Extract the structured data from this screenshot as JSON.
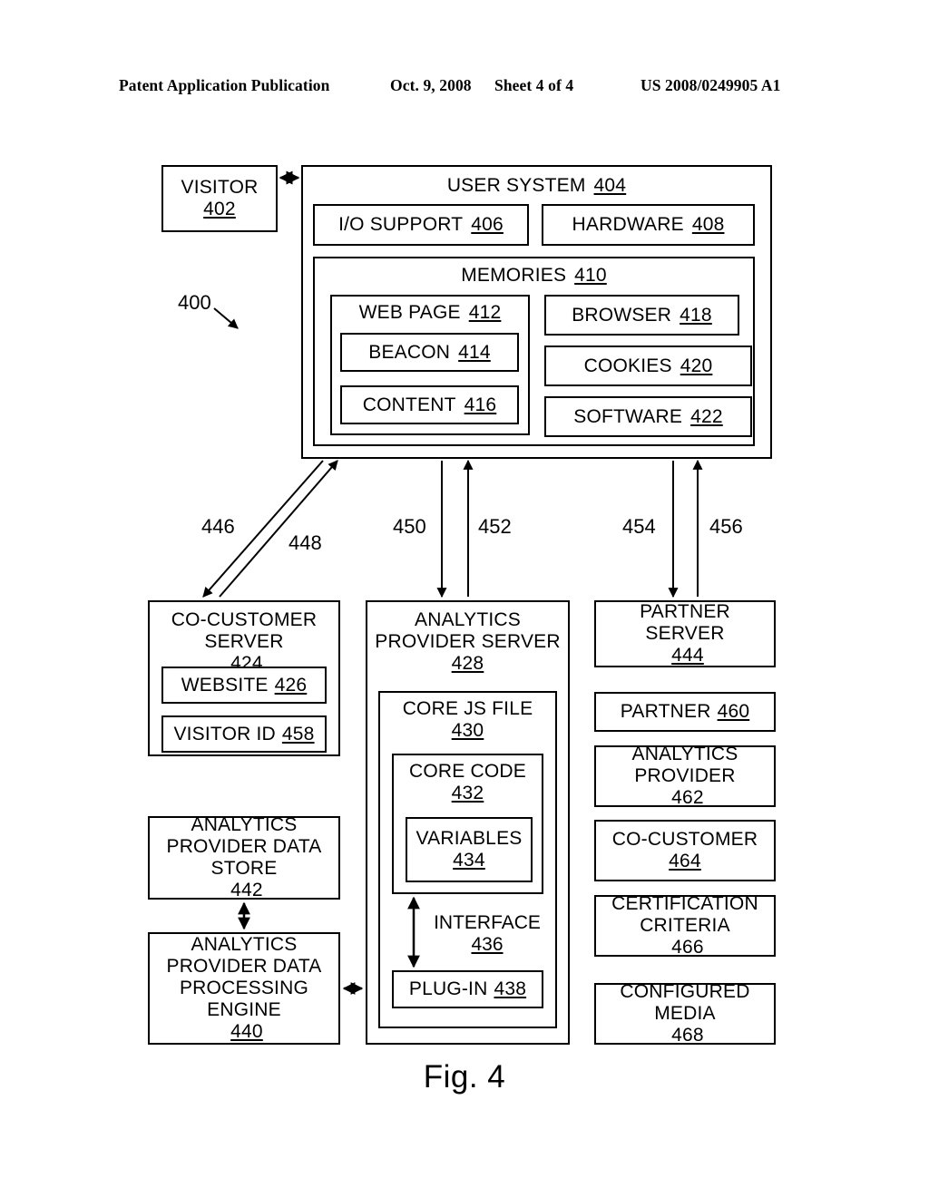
{
  "header": {
    "publication": "Patent Application Publication",
    "date": "Oct. 9, 2008",
    "sheet": "Sheet 4 of 4",
    "number": "US 2008/0249905 A1"
  },
  "figure": {
    "caption": "Fig. 4",
    "system_ref": "400"
  },
  "diagram": {
    "visitor": {
      "label": "VISITOR",
      "ref": "402"
    },
    "user_system": {
      "label": "USER SYSTEM",
      "ref": "404"
    },
    "io_support": {
      "label": "I/O SUPPORT",
      "ref": "406"
    },
    "hardware": {
      "label": "HARDWARE",
      "ref": "408"
    },
    "memories": {
      "label": "MEMORIES",
      "ref": "410"
    },
    "web_page": {
      "label": "WEB PAGE",
      "ref": "412"
    },
    "beacon": {
      "label": "BEACON",
      "ref": "414"
    },
    "content": {
      "label": "CONTENT",
      "ref": "416"
    },
    "browser": {
      "label": "BROWSER",
      "ref": "418"
    },
    "cookies": {
      "label": "COOKIES",
      "ref": "420"
    },
    "software": {
      "label": "SOFTWARE",
      "ref": "422"
    },
    "co_customer_server": {
      "label": "CO-CUSTOMER\nSERVER",
      "ref": "424"
    },
    "website": {
      "label": "WEBSITE",
      "ref": "426"
    },
    "visitor_id": {
      "label": "VISITOR ID",
      "ref": "458"
    },
    "ap_data_store": {
      "label": "ANALYTICS\nPROVIDER DATA\nSTORE",
      "ref": "442"
    },
    "ap_data_engine": {
      "label": "ANALYTICS\nPROVIDER DATA\nPROCESSING\nENGINE",
      "ref": "440"
    },
    "ap_server": {
      "label": "ANALYTICS\nPROVIDER SERVER",
      "ref": "428"
    },
    "core_js_file": {
      "label": "CORE JS FILE",
      "ref": "430"
    },
    "core_code": {
      "label": "CORE CODE",
      "ref": "432"
    },
    "variables": {
      "label": "VARIABLES",
      "ref": "434"
    },
    "interface": {
      "label": "INTERFACE",
      "ref": "436"
    },
    "plugin": {
      "label": "PLUG-IN",
      "ref": "438"
    },
    "partner_server": {
      "label": "PARTNER\nSERVER",
      "ref": "444"
    },
    "partner": {
      "label": "PARTNER",
      "ref": "460"
    },
    "analytics_provider": {
      "label": "ANALYTICS\nPROVIDER",
      "ref": "462"
    },
    "co_customer": {
      "label": "CO-CUSTOMER",
      "ref": "464"
    },
    "certification_criteria": {
      "label": "CERTIFICATION\nCRITERIA",
      "ref": "466"
    },
    "configured_media": {
      "label": "CONFIGURED\nMEDIA",
      "ref": "468"
    }
  },
  "connectors": {
    "c446": "446",
    "c448": "448",
    "c450": "450",
    "c452": "452",
    "c454": "454",
    "c456": "456"
  }
}
